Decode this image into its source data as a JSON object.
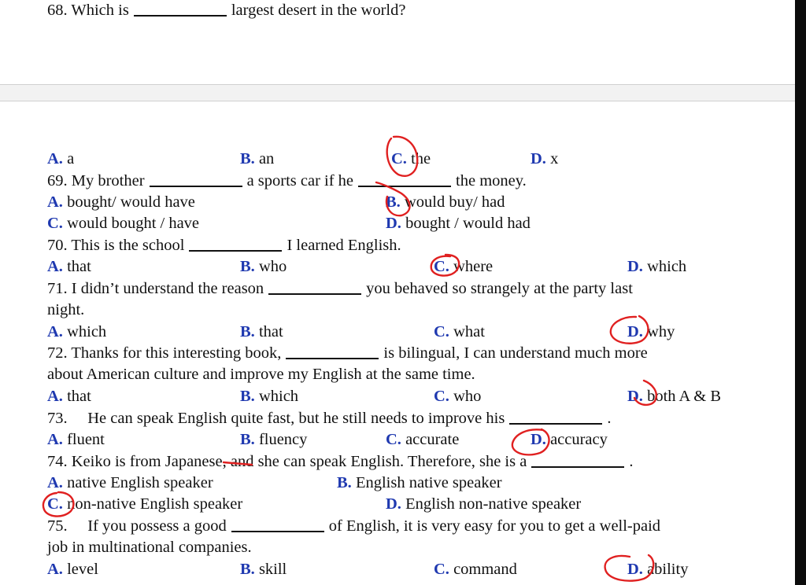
{
  "q68": {
    "pre": "68. Which is",
    "post": "largest desert in the world?",
    "options": [
      {
        "l": "A.",
        "t": "a"
      },
      {
        "l": "B.",
        "t": "an"
      },
      {
        "l": "C.",
        "t": "the"
      },
      {
        "l": "D.",
        "t": "x"
      }
    ]
  },
  "q69": {
    "a": "69. My brother",
    "b": "a sports car if he",
    "c": "the money.",
    "options": [
      {
        "l": "A.",
        "t": "bought/ would have"
      },
      {
        "l": "B.",
        "t": "would buy/ had"
      },
      {
        "l": "C.",
        "t": "would bought / have"
      },
      {
        "l": "D.",
        "t": "bought / would had"
      }
    ]
  },
  "q70": {
    "pre": "70. This is the school",
    "post": "I learned English.",
    "options": [
      {
        "l": "A.",
        "t": "that"
      },
      {
        "l": "B.",
        "t": "who"
      },
      {
        "l": "C.",
        "t": "where"
      },
      {
        "l": "D.",
        "t": "which"
      }
    ]
  },
  "q71": {
    "pre": "71. I didn’t understand the reason",
    "post": "you behaved so strangely at the party last",
    "line2": "night.",
    "options": [
      {
        "l": "A.",
        "t": "which"
      },
      {
        "l": "B.",
        "t": "that"
      },
      {
        "l": "C.",
        "t": "what"
      },
      {
        "l": "D.",
        "t": "why"
      }
    ]
  },
  "q72": {
    "pre": "72. Thanks for this interesting book,",
    "post": "is bilingual, I can understand much more",
    "line2": "about American culture and improve my English at the same time.",
    "options": [
      {
        "l": "A.",
        "t": "that"
      },
      {
        "l": "B.",
        "t": "which"
      },
      {
        "l": "C.",
        "t": "who"
      },
      {
        "l": "D.",
        "t": "both A & B"
      }
    ]
  },
  "q73": {
    "pre": "73.     He can speak English quite fast, but he still needs to improve his",
    "post": ".",
    "options": [
      {
        "l": "A.",
        "t": "fluent"
      },
      {
        "l": "B.",
        "t": "fluency"
      },
      {
        "l": "C.",
        "t": "accurate"
      },
      {
        "l": "D.",
        "t": "accuracy"
      }
    ]
  },
  "q74": {
    "pre": "74. Keiko is from Japanese, and she can speak English. Therefore, she is a",
    "post": ".",
    "options": [
      {
        "l": "A.",
        "t": "native English speaker"
      },
      {
        "l": "B.",
        "t": "English native speaker"
      },
      {
        "l": "C.",
        "t": "non-native English speaker"
      },
      {
        "l": "D.",
        "t": "English non-native speaker"
      }
    ]
  },
  "q75": {
    "pre": "75.     If you possess a good",
    "post": "of English, it is very easy for you to get a well-paid",
    "line2": "job in multinational companies.",
    "options": [
      {
        "l": "A.",
        "t": "level"
      },
      {
        "l": "B.",
        "t": "skill"
      },
      {
        "l": "C.",
        "t": "command"
      },
      {
        "l": "D.",
        "t": "ability"
      }
    ]
  },
  "colors": {
    "option_letter": "#1f39b0",
    "answer_mark": "#e02020"
  }
}
